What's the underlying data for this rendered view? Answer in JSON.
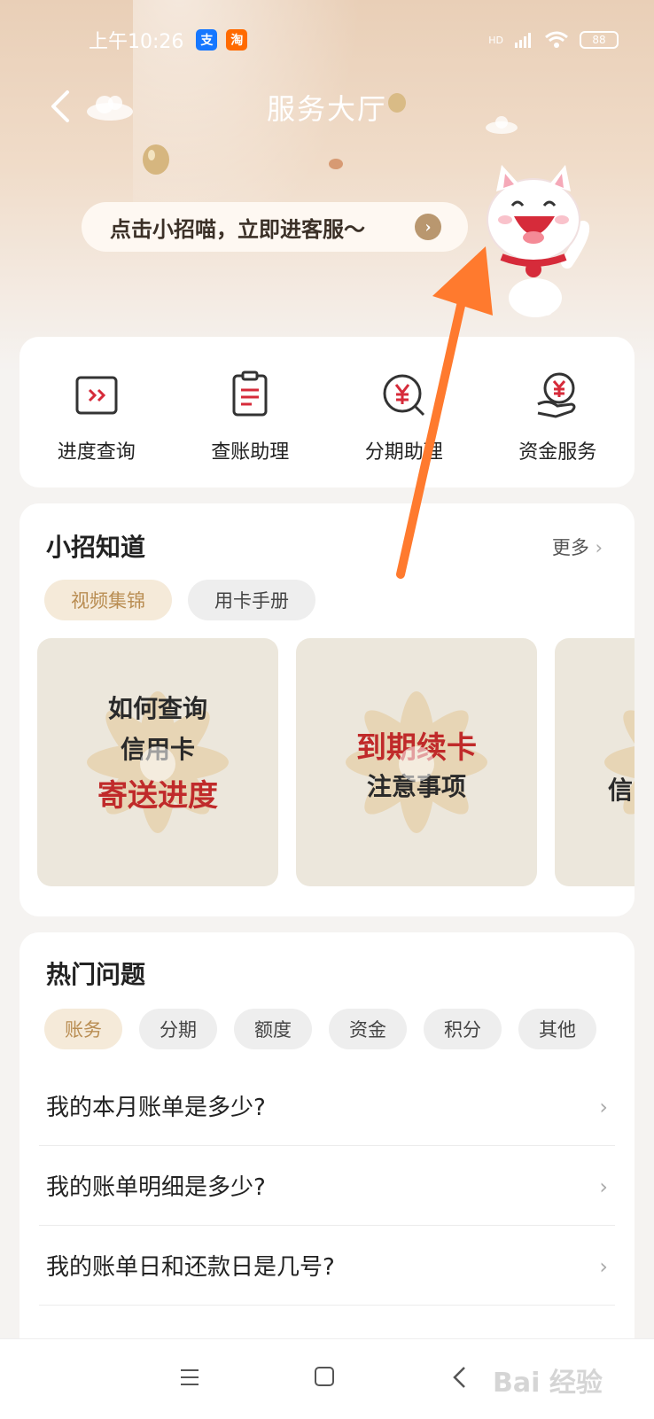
{
  "status_bar": {
    "time": "上午10:26",
    "battery": "88",
    "network": "HD",
    "app_badges": [
      "支",
      "淘"
    ]
  },
  "header": {
    "title": "服务大厅",
    "bubble_text": "点击小招喵，立即进客服～"
  },
  "services": [
    {
      "label": "进度查询",
      "icon": "progress-icon"
    },
    {
      "label": "查账助理",
      "icon": "bill-icon"
    },
    {
      "label": "分期助理",
      "icon": "installment-icon"
    },
    {
      "label": "资金服务",
      "icon": "fund-icon"
    }
  ],
  "knowledge": {
    "title": "小招知道",
    "more": "更多",
    "tabs": [
      "视频集锦",
      "用卡手册"
    ],
    "videos": [
      {
        "lines": [
          "如何查询",
          "信用卡"
        ],
        "highlight": "寄送进度"
      },
      {
        "highlight": "到期续卡",
        "lines": [
          "注意事项"
        ]
      },
      {
        "partial": "信"
      }
    ]
  },
  "hot": {
    "title": "热门问题",
    "tabs": [
      "账务",
      "分期",
      "额度",
      "资金",
      "积分",
      "其他"
    ],
    "questions": [
      "我的本月账单是多少?",
      "我的账单明细是多少?",
      "我的账单日和还款日是几号?"
    ]
  },
  "watermark": "Bai 经验",
  "colors": {
    "accent": "#b98d52",
    "highlight_red": "#c02a2a",
    "arrow": "#ff7a2e"
  }
}
